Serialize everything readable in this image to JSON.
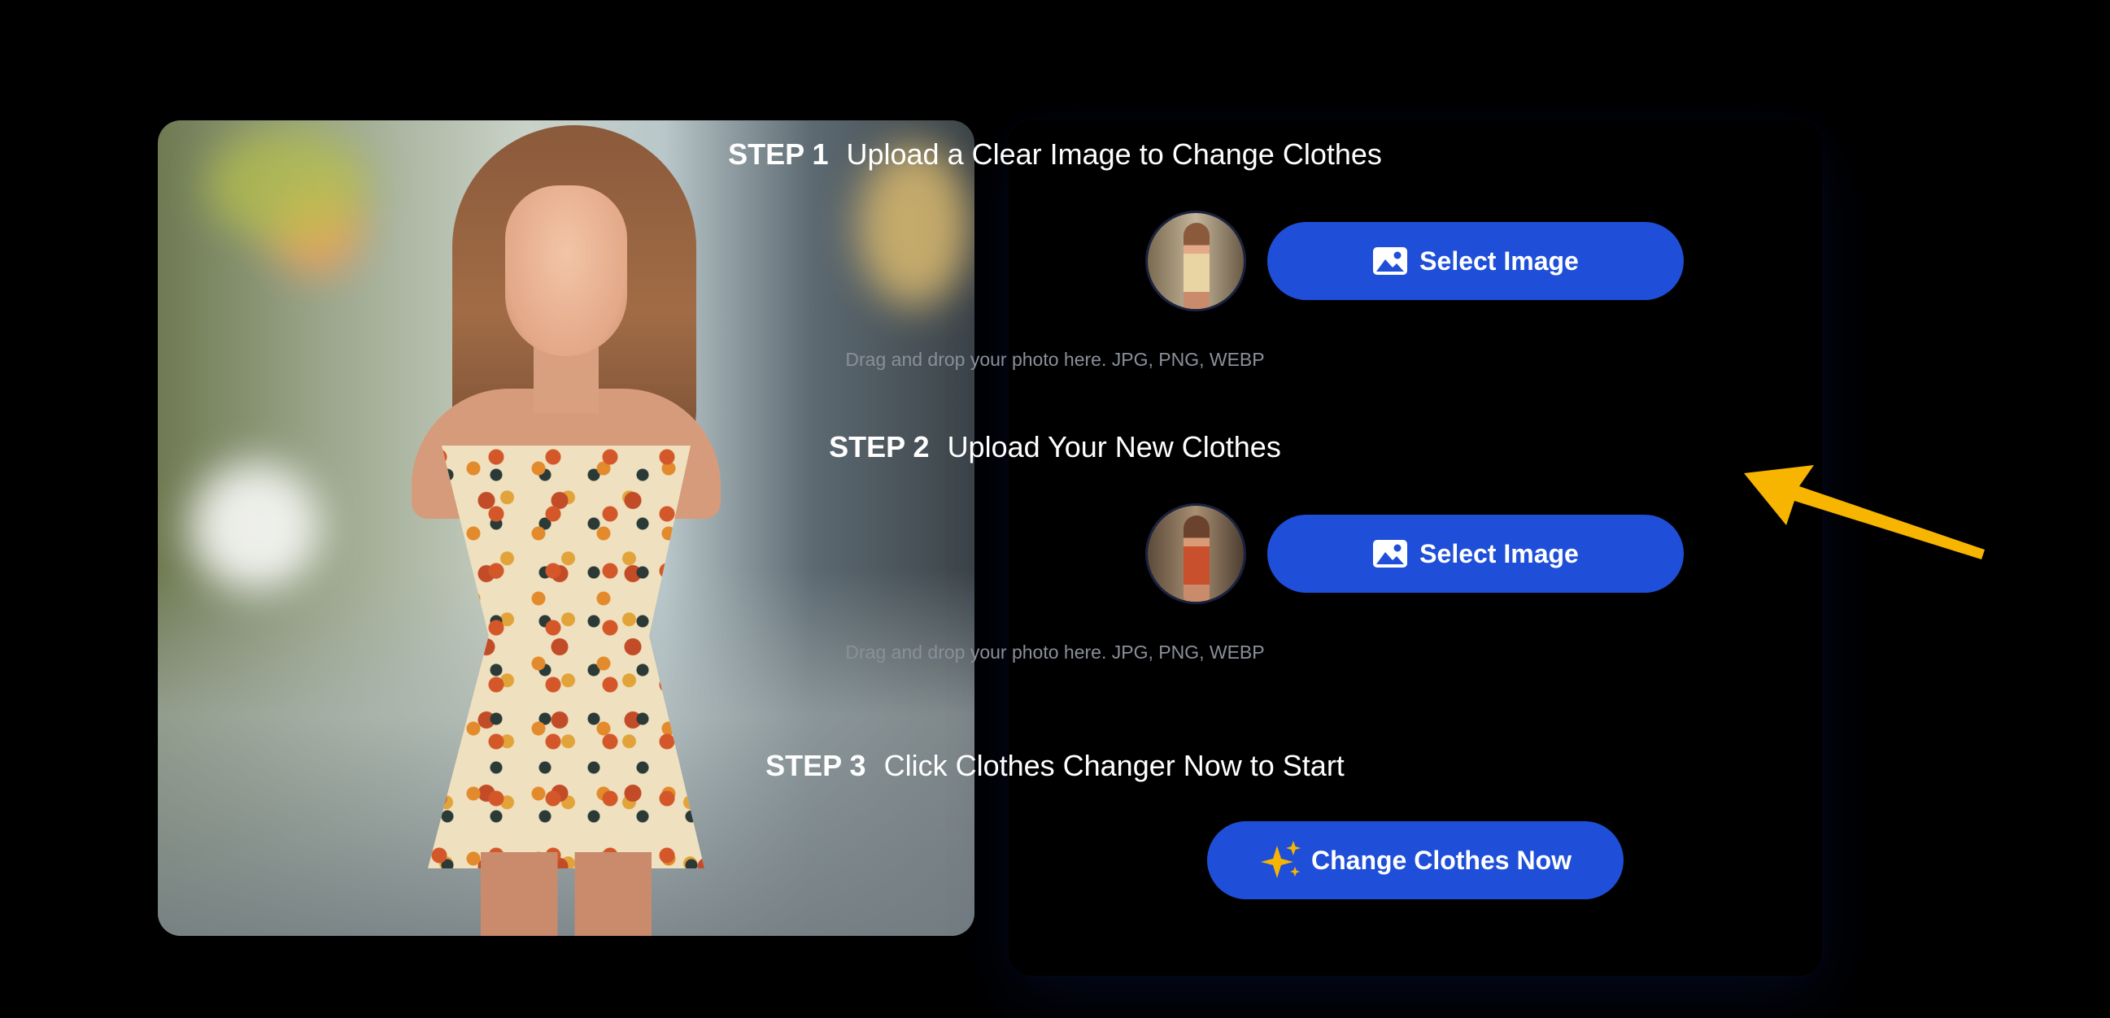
{
  "preview": {
    "alt": "Woman in floral off-shoulder dress on a city street"
  },
  "step1": {
    "label": "STEP 1",
    "text": "Upload a Clear Image to Change Clothes",
    "button_label": "Select Image",
    "hint": "Drag and drop your photo here. JPG, PNG, WEBP"
  },
  "step2": {
    "label": "STEP 2",
    "text": "Upload Your New Clothes",
    "button_label": "Select Image",
    "hint": "Drag and drop your photo here. JPG, PNG, WEBP"
  },
  "step3": {
    "label": "STEP 3",
    "text": "Click Clothes Changer Now to Start",
    "button_label": "Change Clothes Now"
  },
  "icons": {
    "select": "image-icon",
    "cta": "sparkles-icon",
    "pointer": "arrow-pointer-icon"
  },
  "colors": {
    "background": "#000000",
    "button": "#1f4fd8",
    "hint_text": "#8a8f9a",
    "arrow": "#f7b500",
    "sparkle": "#f7b500"
  }
}
